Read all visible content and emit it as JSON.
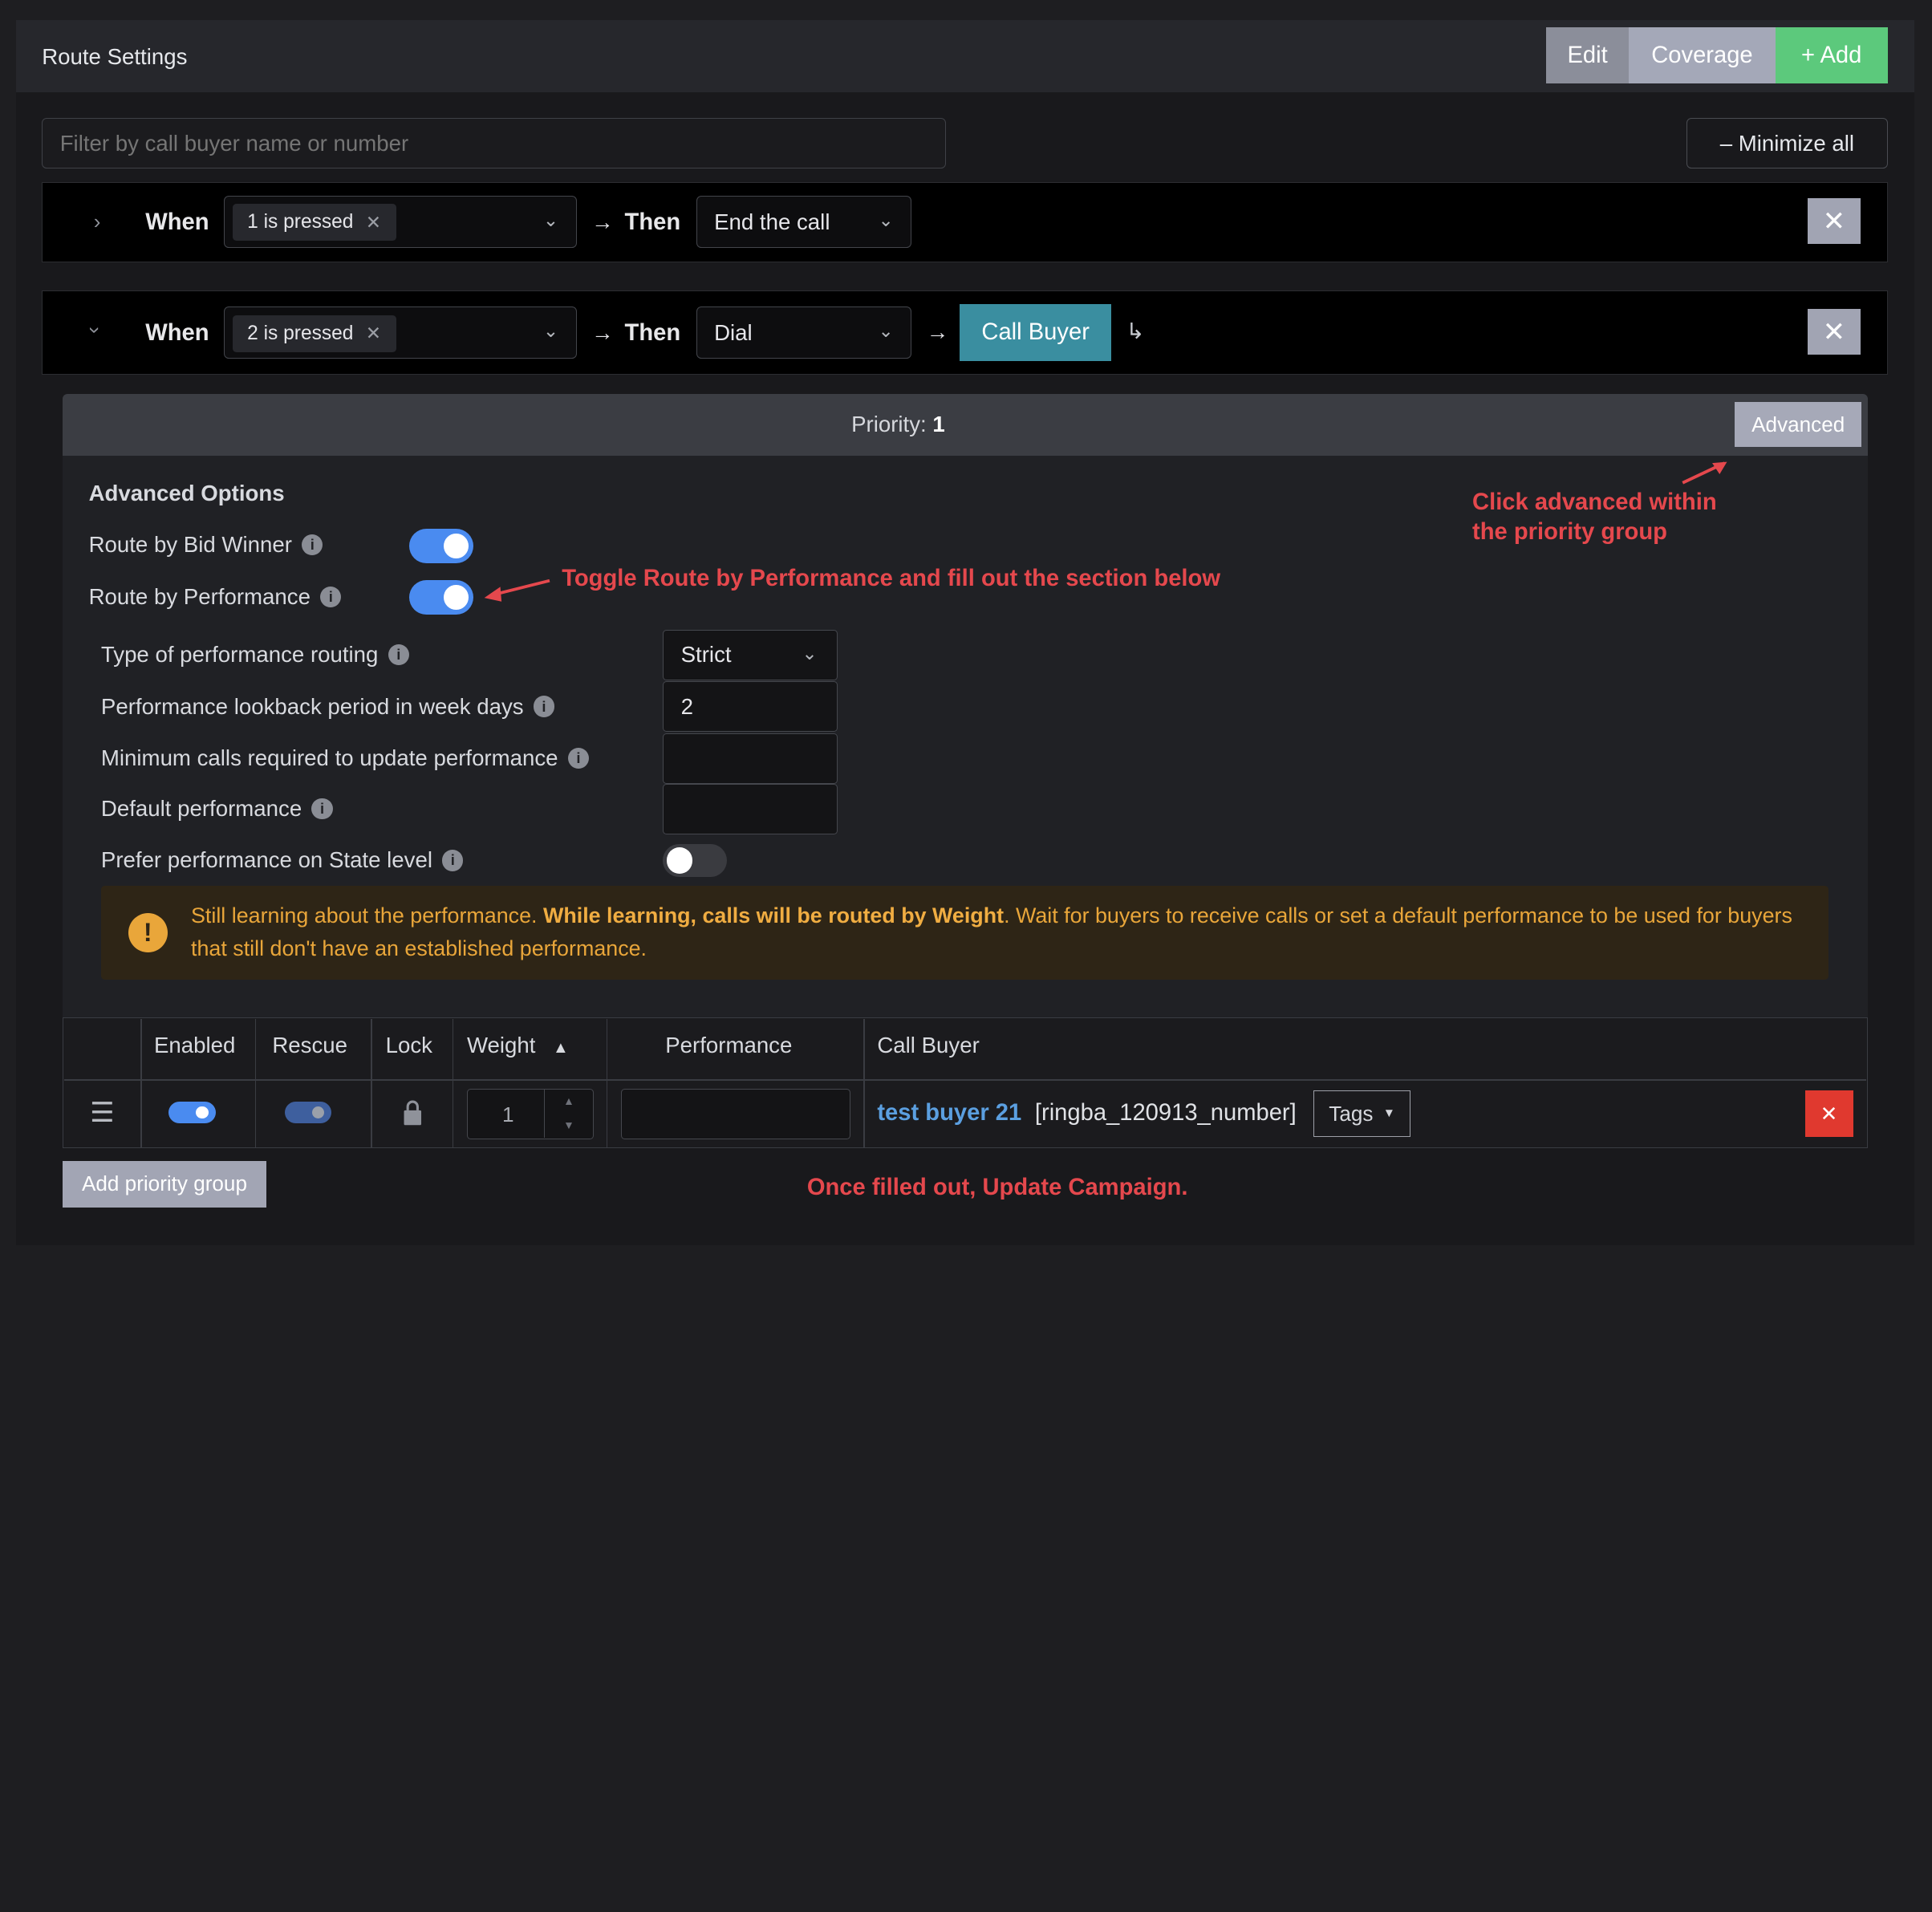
{
  "header": {
    "title": "Route Settings",
    "edit": "Edit",
    "coverage": "Coverage",
    "add": "+ Add"
  },
  "filter": {
    "placeholder": "Filter by call buyer name or number"
  },
  "minimize_all": "– Minimize all",
  "rule1": {
    "when": "When",
    "condition": "1 is pressed",
    "then": "Then",
    "action": "End the call"
  },
  "rule2": {
    "when": "When",
    "condition": "2 is pressed",
    "then": "Then",
    "action": "Dial",
    "target": "Call Buyer"
  },
  "priority": {
    "label": "Priority:",
    "value": "1",
    "advanced": "Advanced"
  },
  "advanced": {
    "title": "Advanced Options",
    "bid_winner": "Route by Bid Winner",
    "performance": "Route by Performance",
    "type_label": "Type of performance routing",
    "type_value": "Strict",
    "lookback_label": "Performance lookback period in week days",
    "lookback_value": "2",
    "min_calls_label": "Minimum calls required to update performance",
    "default_perf_label": "Default performance",
    "state_label": "Prefer performance on State level"
  },
  "warning": {
    "pre": "Still learning about the performance. ",
    "bold": "While learning, calls will be routed by Weight",
    "post": ". Wait for buyers to receive calls or set a default performance to be used for buyers that still don't have an established performance."
  },
  "table": {
    "headers": {
      "enabled": "Enabled",
      "rescue": "Rescue",
      "lock": "Lock",
      "weight": "Weight",
      "performance": "Performance",
      "call_buyer": "Call Buyer"
    },
    "row": {
      "weight": "1",
      "buyer_name": "test buyer 21",
      "buyer_number": "[ringba_120913_number]",
      "tags": "Tags"
    }
  },
  "add_priority_group": "Add priority group",
  "annotations": {
    "advanced": "Click advanced within\nthe priority group",
    "toggle": "Toggle Route by Performance and fill out the section below",
    "update": "Once filled out, Update Campaign."
  },
  "colors": {
    "accent": "#3a8ea0",
    "toggle_on": "#4a8bf0",
    "annotation": "#e5484d",
    "warning": "#e9a63a"
  }
}
